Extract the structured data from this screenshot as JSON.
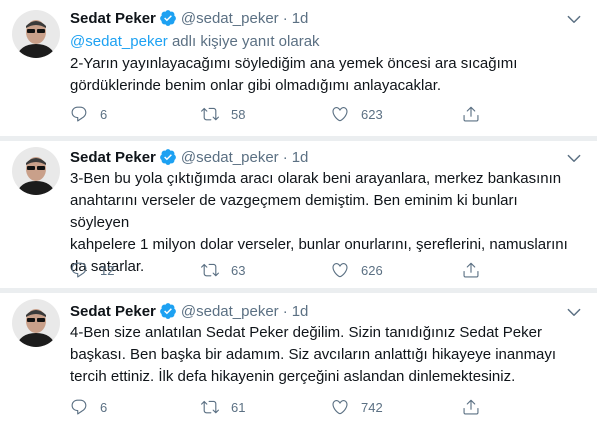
{
  "colors": {
    "accent": "#1da1f2",
    "verified": "#1da1f2",
    "muted": "#5b7083",
    "text": "#0f1419"
  },
  "tweets": [
    {
      "name": "Sedat Peker",
      "handle": "@sedat_peker",
      "dot": "·",
      "time": "1d",
      "replying_mention": "@sedat_peker",
      "replying_suffix": " adlı kişiye yanıt olarak",
      "lines": [
        "2-Yarın yayınlayacağımı söylediğim ana yemek öncesi ara sıcağımı",
        "gördüklerinde benim onlar gibi olmadığımı anlayacaklar."
      ],
      "replies": "6",
      "retweets": "58",
      "likes": "623"
    },
    {
      "name": "Sedat Peker",
      "handle": "@sedat_peker",
      "dot": "·",
      "time": "1d",
      "lines": [
        "3-Ben bu yola çıktığımda aracı olarak beni arayanlara, merkez bankasının",
        "anahtarını verseler de vazgeçmem demiştim. Ben eminim ki bunları söyleyen",
        "kahpelere 1 milyon dolar verseler, bunlar onurlarını, şereflerini, namuslarını",
        "da satarlar."
      ],
      "replies": "12",
      "retweets": "63",
      "likes": "626"
    },
    {
      "name": "Sedat Peker",
      "handle": "@sedat_peker",
      "dot": "·",
      "time": "1d",
      "lines": [
        "4-Ben size anlatılan Sedat Peker değilim. Sizin tanıdığınız Sedat Peker",
        "başkası. Ben başka bir adamım. Siz avcıların anlattığı hikayeye inanmayı",
        "tercih ettiniz. İlk defa hikayenin gerçeğini aslandan dinlemektesiniz."
      ],
      "replies": "6",
      "retweets": "61",
      "likes": "742"
    }
  ]
}
